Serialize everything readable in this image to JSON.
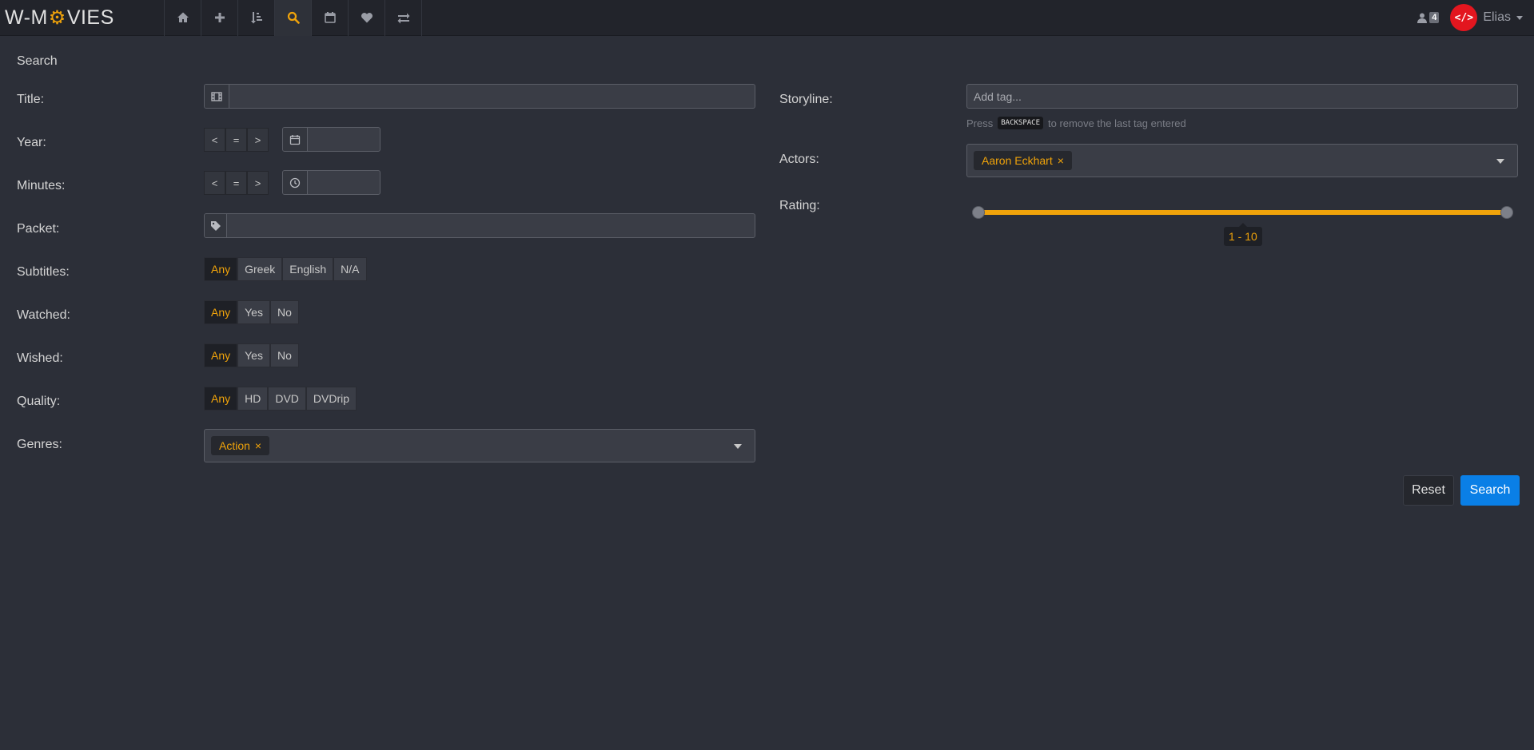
{
  "navbar": {
    "brand_left": "W-M",
    "brand_right": "VIES",
    "tabs": [
      {
        "icon": "home-icon",
        "active": false
      },
      {
        "icon": "plus-icon",
        "active": false
      },
      {
        "icon": "sort-icon",
        "active": false
      },
      {
        "icon": "search-icon",
        "active": true
      },
      {
        "icon": "calendar-icon",
        "active": false
      },
      {
        "icon": "heart-icon",
        "active": false
      },
      {
        "icon": "exchange-icon",
        "active": false
      }
    ],
    "users_count": "4",
    "avatar_text": "</>",
    "username": "Elias"
  },
  "page": {
    "title": "Search"
  },
  "form": {
    "title_label": "Title:",
    "title_value": "",
    "year_label": "Year:",
    "year_ops": [
      "<",
      "=",
      ">"
    ],
    "year_value": "",
    "minutes_label": "Minutes:",
    "minutes_ops": [
      "<",
      "=",
      ">"
    ],
    "minutes_value": "",
    "packet_label": "Packet:",
    "packet_value": "",
    "subtitles_label": "Subtitles:",
    "subtitles_options": [
      "Any",
      "Greek",
      "English",
      "N/A"
    ],
    "subtitles_selected": "Any",
    "watched_label": "Watched:",
    "watched_options": [
      "Any",
      "Yes",
      "No"
    ],
    "watched_selected": "Any",
    "wished_label": "Wished:",
    "wished_options": [
      "Any",
      "Yes",
      "No"
    ],
    "wished_selected": "Any",
    "quality_label": "Quality:",
    "quality_options": [
      "Any",
      "HD",
      "DVD",
      "DVDrip"
    ],
    "quality_selected": "Any",
    "genres_label": "Genres:",
    "genres_selected": [
      "Action"
    ],
    "storyline_label": "Storyline:",
    "storyline_placeholder": "Add tag...",
    "storyline_help_pre": "Press",
    "storyline_help_key": "BACKSPACE",
    "storyline_help_post": "to remove the last tag entered",
    "actors_label": "Actors:",
    "actors_selected": [
      "Aaron Eckhart"
    ],
    "rating_label": "Rating:",
    "rating_min": 1,
    "rating_max": 10,
    "rating_range_text": "1 - 10",
    "reset_label": "Reset",
    "search_label": "Search"
  },
  "colors": {
    "accent": "#f0a30a",
    "primary": "#0a7fe6",
    "background": "#2c2f38",
    "navbar": "#22242b"
  }
}
